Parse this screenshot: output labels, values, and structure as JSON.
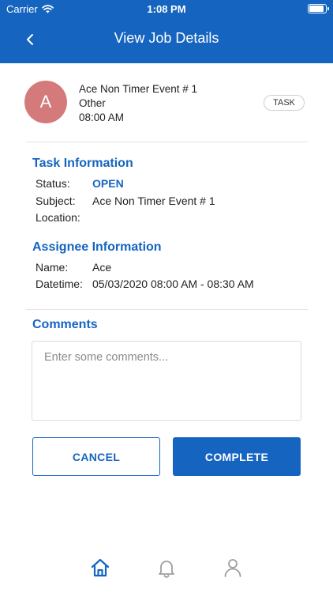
{
  "status_bar": {
    "carrier": "Carrier",
    "time": "1:08 PM"
  },
  "header": {
    "title": "View Job Details",
    "background": "#1565c0"
  },
  "job": {
    "avatar_initial": "A",
    "avatar_color": "#d47a7a",
    "name": "Ace Non Timer Event # 1",
    "category": "Other",
    "time": "08:00 AM",
    "badge": "TASK"
  },
  "task_info": {
    "title": "Task Information",
    "status_label": "Status:",
    "status_value": "OPEN",
    "subject_label": "Subject:",
    "subject_value": "Ace Non Timer Event # 1",
    "location_label": "Location:"
  },
  "assignee_info": {
    "title": "Assignee Information",
    "name_label": "Name:",
    "name_value": "Ace",
    "datetime_label": "Datetime:",
    "datetime_value": "05/03/2020 08:00 AM - 08:30 AM"
  },
  "comments": {
    "title": "Comments",
    "placeholder": "Enter some comments...",
    "value": ""
  },
  "actions": {
    "cancel_label": "CANCEL",
    "complete_label": "COMPLETE"
  },
  "tabbar": {
    "active_color": "#1565c0",
    "inactive_color": "#9e9e9e",
    "tabs": [
      {
        "icon": "home-icon",
        "active": true
      },
      {
        "icon": "bell-icon",
        "active": false
      },
      {
        "icon": "person-icon",
        "active": false
      }
    ]
  }
}
